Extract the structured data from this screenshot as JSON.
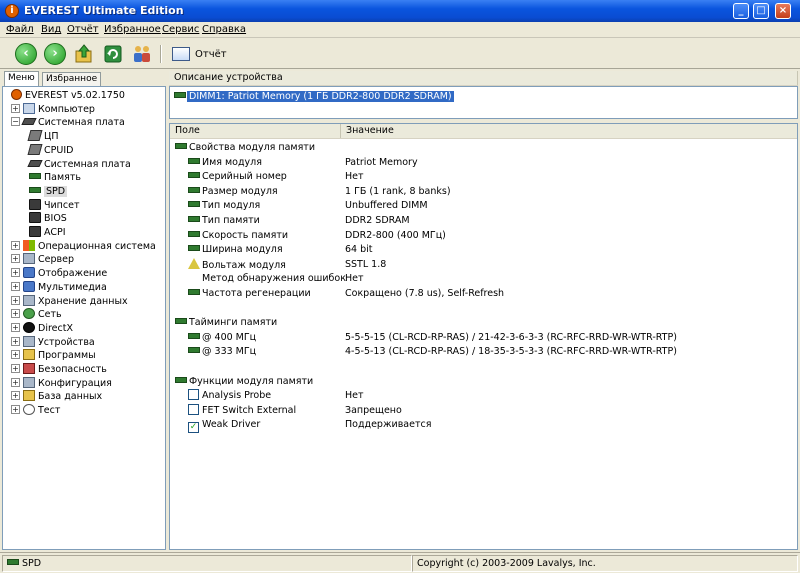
{
  "window": {
    "title": "EVEREST Ultimate Edition"
  },
  "menu": [
    "Файл",
    "Вид",
    "Отчёт",
    "Избранное",
    "Сервис",
    "Справка"
  ],
  "toolbar": {
    "report_label": "Отчёт"
  },
  "left": {
    "tabs": [
      "Меню",
      "Избранное"
    ],
    "tree": [
      {
        "label": "EVEREST v5.02.1750",
        "icon": "info-icon",
        "level": 0,
        "exp": ""
      },
      {
        "label": "Компьютер",
        "icon": "computer-icon",
        "level": 0,
        "exp": "+"
      },
      {
        "label": "Системная плата",
        "icon": "motherboard-icon",
        "level": 0,
        "exp": "−"
      },
      {
        "label": "ЦП",
        "icon": "cpu-icon",
        "level": 1,
        "exp": ""
      },
      {
        "label": "CPUID",
        "icon": "cpuid-icon",
        "level": 1,
        "exp": ""
      },
      {
        "label": "Системная плата",
        "icon": "motherboard-icon",
        "level": 1,
        "exp": ""
      },
      {
        "label": "Память",
        "icon": "memory-icon",
        "level": 1,
        "exp": ""
      },
      {
        "label": "SPD",
        "icon": "memory-icon",
        "level": 1,
        "exp": "",
        "selected": true
      },
      {
        "label": "Чипсет",
        "icon": "chipset-icon",
        "level": 1,
        "exp": ""
      },
      {
        "label": "BIOS",
        "icon": "bios-icon",
        "level": 1,
        "exp": ""
      },
      {
        "label": "ACPI",
        "icon": "acpi-icon",
        "level": 1,
        "exp": ""
      },
      {
        "label": "Операционная система",
        "icon": "windows-icon",
        "level": 0,
        "exp": "+"
      },
      {
        "label": "Сервер",
        "icon": "server-icon",
        "level": 0,
        "exp": "+"
      },
      {
        "label": "Отображение",
        "icon": "display-icon",
        "level": 0,
        "exp": "+"
      },
      {
        "label": "Мультимедиа",
        "icon": "multimedia-icon",
        "level": 0,
        "exp": "+"
      },
      {
        "label": "Хранение данных",
        "icon": "storage-icon",
        "level": 0,
        "exp": "+"
      },
      {
        "label": "Сеть",
        "icon": "network-icon",
        "level": 0,
        "exp": "+"
      },
      {
        "label": "DirectX",
        "icon": "directx-icon",
        "level": 0,
        "exp": "+"
      },
      {
        "label": "Устройства",
        "icon": "devices-icon",
        "level": 0,
        "exp": "+"
      },
      {
        "label": "Программы",
        "icon": "programs-icon",
        "level": 0,
        "exp": "+"
      },
      {
        "label": "Безопасность",
        "icon": "security-icon",
        "level": 0,
        "exp": "+"
      },
      {
        "label": "Конфигурация",
        "icon": "config-icon",
        "level": 0,
        "exp": "+"
      },
      {
        "label": "База данных",
        "icon": "database-icon",
        "level": 0,
        "exp": "+"
      },
      {
        "label": "Тест",
        "icon": "benchmark-icon",
        "level": 0,
        "exp": "+"
      }
    ]
  },
  "right": {
    "device_header": "Описание устройства",
    "device": "DIMM1: Patriot Memory (1 ГБ DDR2-800 DDR2 SDRAM)",
    "col_field": "Поле",
    "col_value": "Значение",
    "rows": [
      {
        "field": "Свойства модуля памяти",
        "value": "",
        "kind": "group"
      },
      {
        "field": "Имя модуля",
        "value": "Patriot Memory",
        "kind": "item"
      },
      {
        "field": "Серийный номер",
        "value": "Нет",
        "kind": "item"
      },
      {
        "field": "Размер модуля",
        "value": "1 ГБ (1 rank, 8 banks)",
        "kind": "item"
      },
      {
        "field": "Тип модуля",
        "value": "Unbuffered DIMM",
        "kind": "item"
      },
      {
        "field": "Тип памяти",
        "value": "DDR2 SDRAM",
        "kind": "item"
      },
      {
        "field": "Скорость памяти",
        "value": "DDR2-800 (400 МГц)",
        "kind": "item"
      },
      {
        "field": "Ширина модуля",
        "value": "64 bit",
        "kind": "item"
      },
      {
        "field": "Вольтаж модуля",
        "value": "SSTL 1.8",
        "kind": "warn"
      },
      {
        "field": "Метод обнаружения ошибок",
        "value": "Нет",
        "kind": "plain"
      },
      {
        "field": "Частота регенерации",
        "value": "Сокращено (7.8 us), Self-Refresh",
        "kind": "item"
      },
      {
        "field": "",
        "value": "",
        "kind": "blank"
      },
      {
        "field": "Тайминги памяти",
        "value": "",
        "kind": "group"
      },
      {
        "field": "@ 400 МГц",
        "value": "5-5-5-15  (CL-RCD-RP-RAS) / 21-42-3-6-3-3  (RC-RFC-RRD-WR-WTR-RTP)",
        "kind": "item"
      },
      {
        "field": "@ 333 МГц",
        "value": "4-5-5-13  (CL-RCD-RP-RAS) / 18-35-3-5-3-3  (RC-RFC-RRD-WR-WTR-RTP)",
        "kind": "item"
      },
      {
        "field": "",
        "value": "",
        "kind": "blank"
      },
      {
        "field": "Функции модуля памяти",
        "value": "",
        "kind": "group"
      },
      {
        "field": "Analysis Probe",
        "value": "Нет",
        "kind": "check",
        "checked": false
      },
      {
        "field": "FET Switch External",
        "value": "Запрещено",
        "kind": "check",
        "checked": false
      },
      {
        "field": "Weak Driver",
        "value": "Поддерживается",
        "kind": "check",
        "checked": true
      }
    ]
  },
  "status": {
    "left": "SPD",
    "right": "Copyright (c) 2003-2009 Lavalys, Inc."
  }
}
